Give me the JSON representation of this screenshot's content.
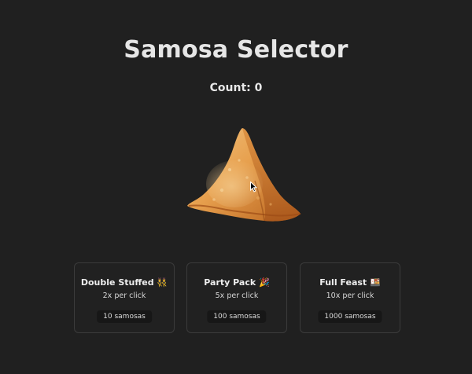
{
  "app": {
    "title": "Samosa Selector",
    "count_label": "Count: 0"
  },
  "samosa": {
    "icon": "samosa-icon"
  },
  "upgrades": [
    {
      "name": "Double Stuffed",
      "emoji": "👯",
      "rate": "2x per click",
      "cost": "10 samosas"
    },
    {
      "name": "Party Pack",
      "emoji": "🎉",
      "rate": "5x per click",
      "cost": "100 samosas"
    },
    {
      "name": "Full Feast",
      "emoji": "🍱",
      "rate": "10x per click",
      "cost": "1000 samosas"
    }
  ],
  "colors": {
    "background": "#202020",
    "card_border": "#3b3b3b",
    "cost_bg": "#171717",
    "samosa_light": "#e8a450",
    "samosa_dark": "#b8651f"
  }
}
